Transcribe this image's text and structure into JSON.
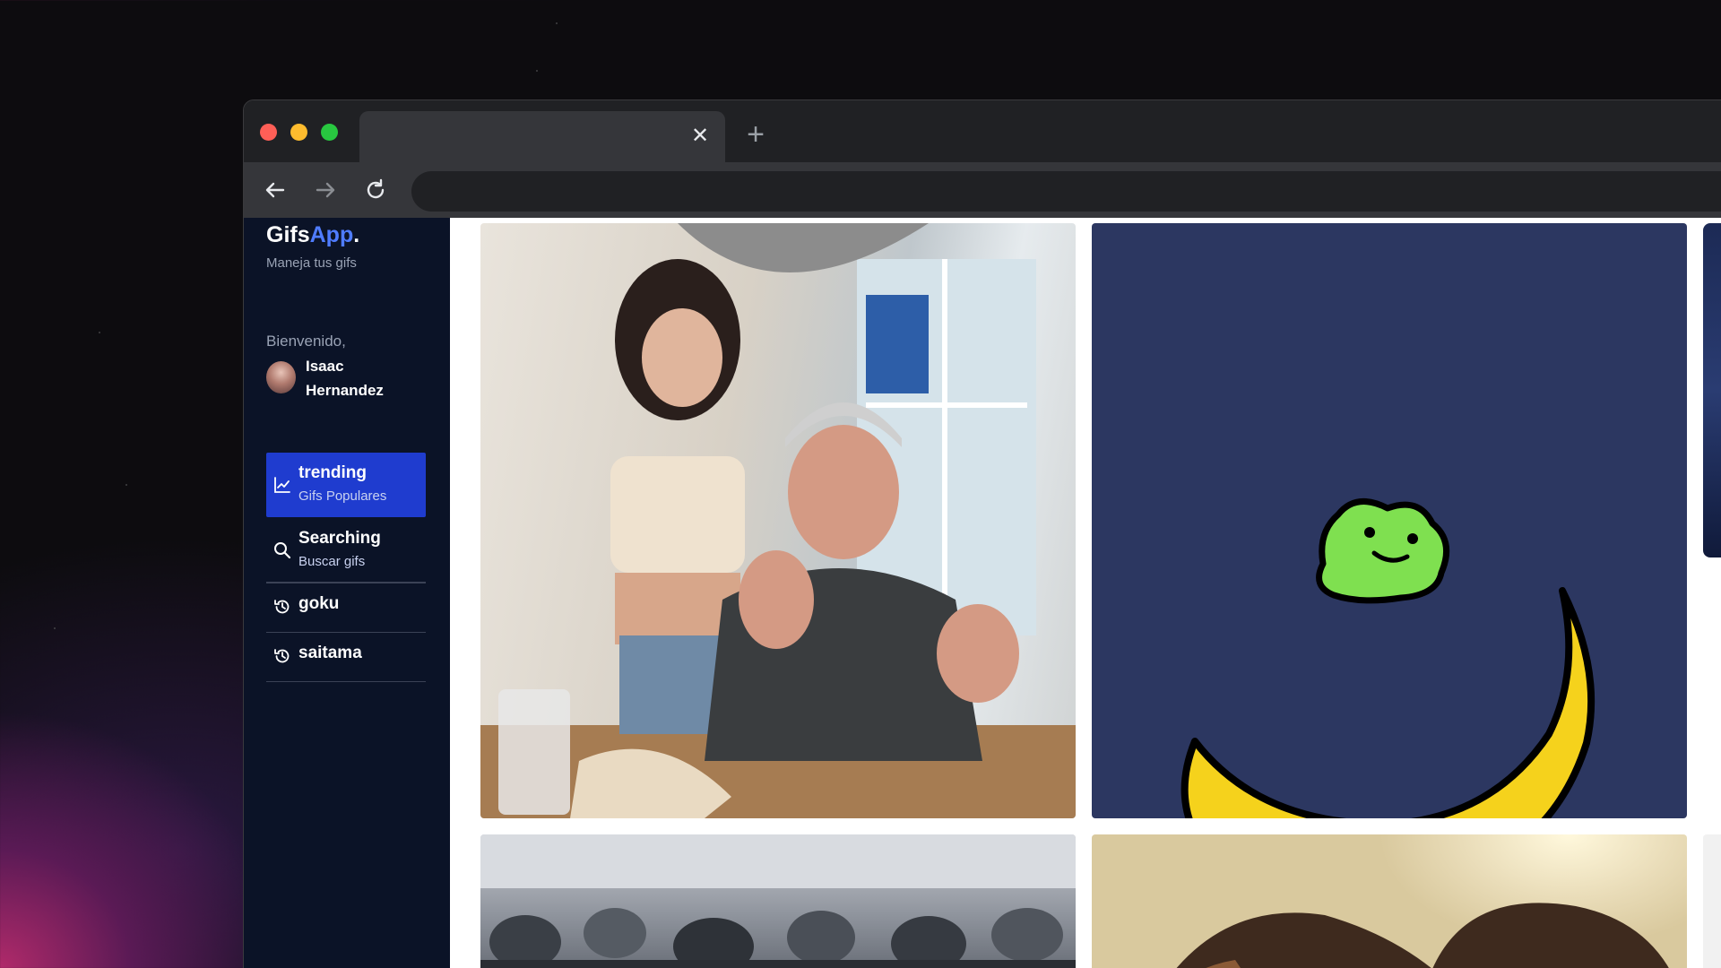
{
  "window": {
    "tab_close_icon": "close-icon",
    "new_tab_icon": "plus-icon"
  },
  "toolbar": {
    "back_icon": "arrow-left-icon",
    "forward_icon": "arrow-right-icon",
    "reload_icon": "reload-icon",
    "address_value": ""
  },
  "brand": {
    "name_main": "Gifs",
    "name_accent": "App",
    "name_suffix": ".",
    "subtitle": "Maneja tus gifs",
    "accent_color": "#4f7cff"
  },
  "user": {
    "greeting": "Bienvenido,",
    "name": "Isaac Hernandez"
  },
  "menu": [
    {
      "title": "trending",
      "subtitle": "Gifs Populares",
      "icon": "trending-chart-icon",
      "active": true
    },
    {
      "title": "Searching",
      "subtitle": "Buscar gifs",
      "icon": "search-icon",
      "active": false
    }
  ],
  "history": [
    {
      "label": "goku",
      "icon": "history-icon"
    },
    {
      "label": "saitama",
      "icon": "history-icon"
    }
  ],
  "colors": {
    "sidebar_bg": "#0b1327",
    "active_menu_bg": "#1f3ccf",
    "gallery_bg": "#ffffff"
  }
}
